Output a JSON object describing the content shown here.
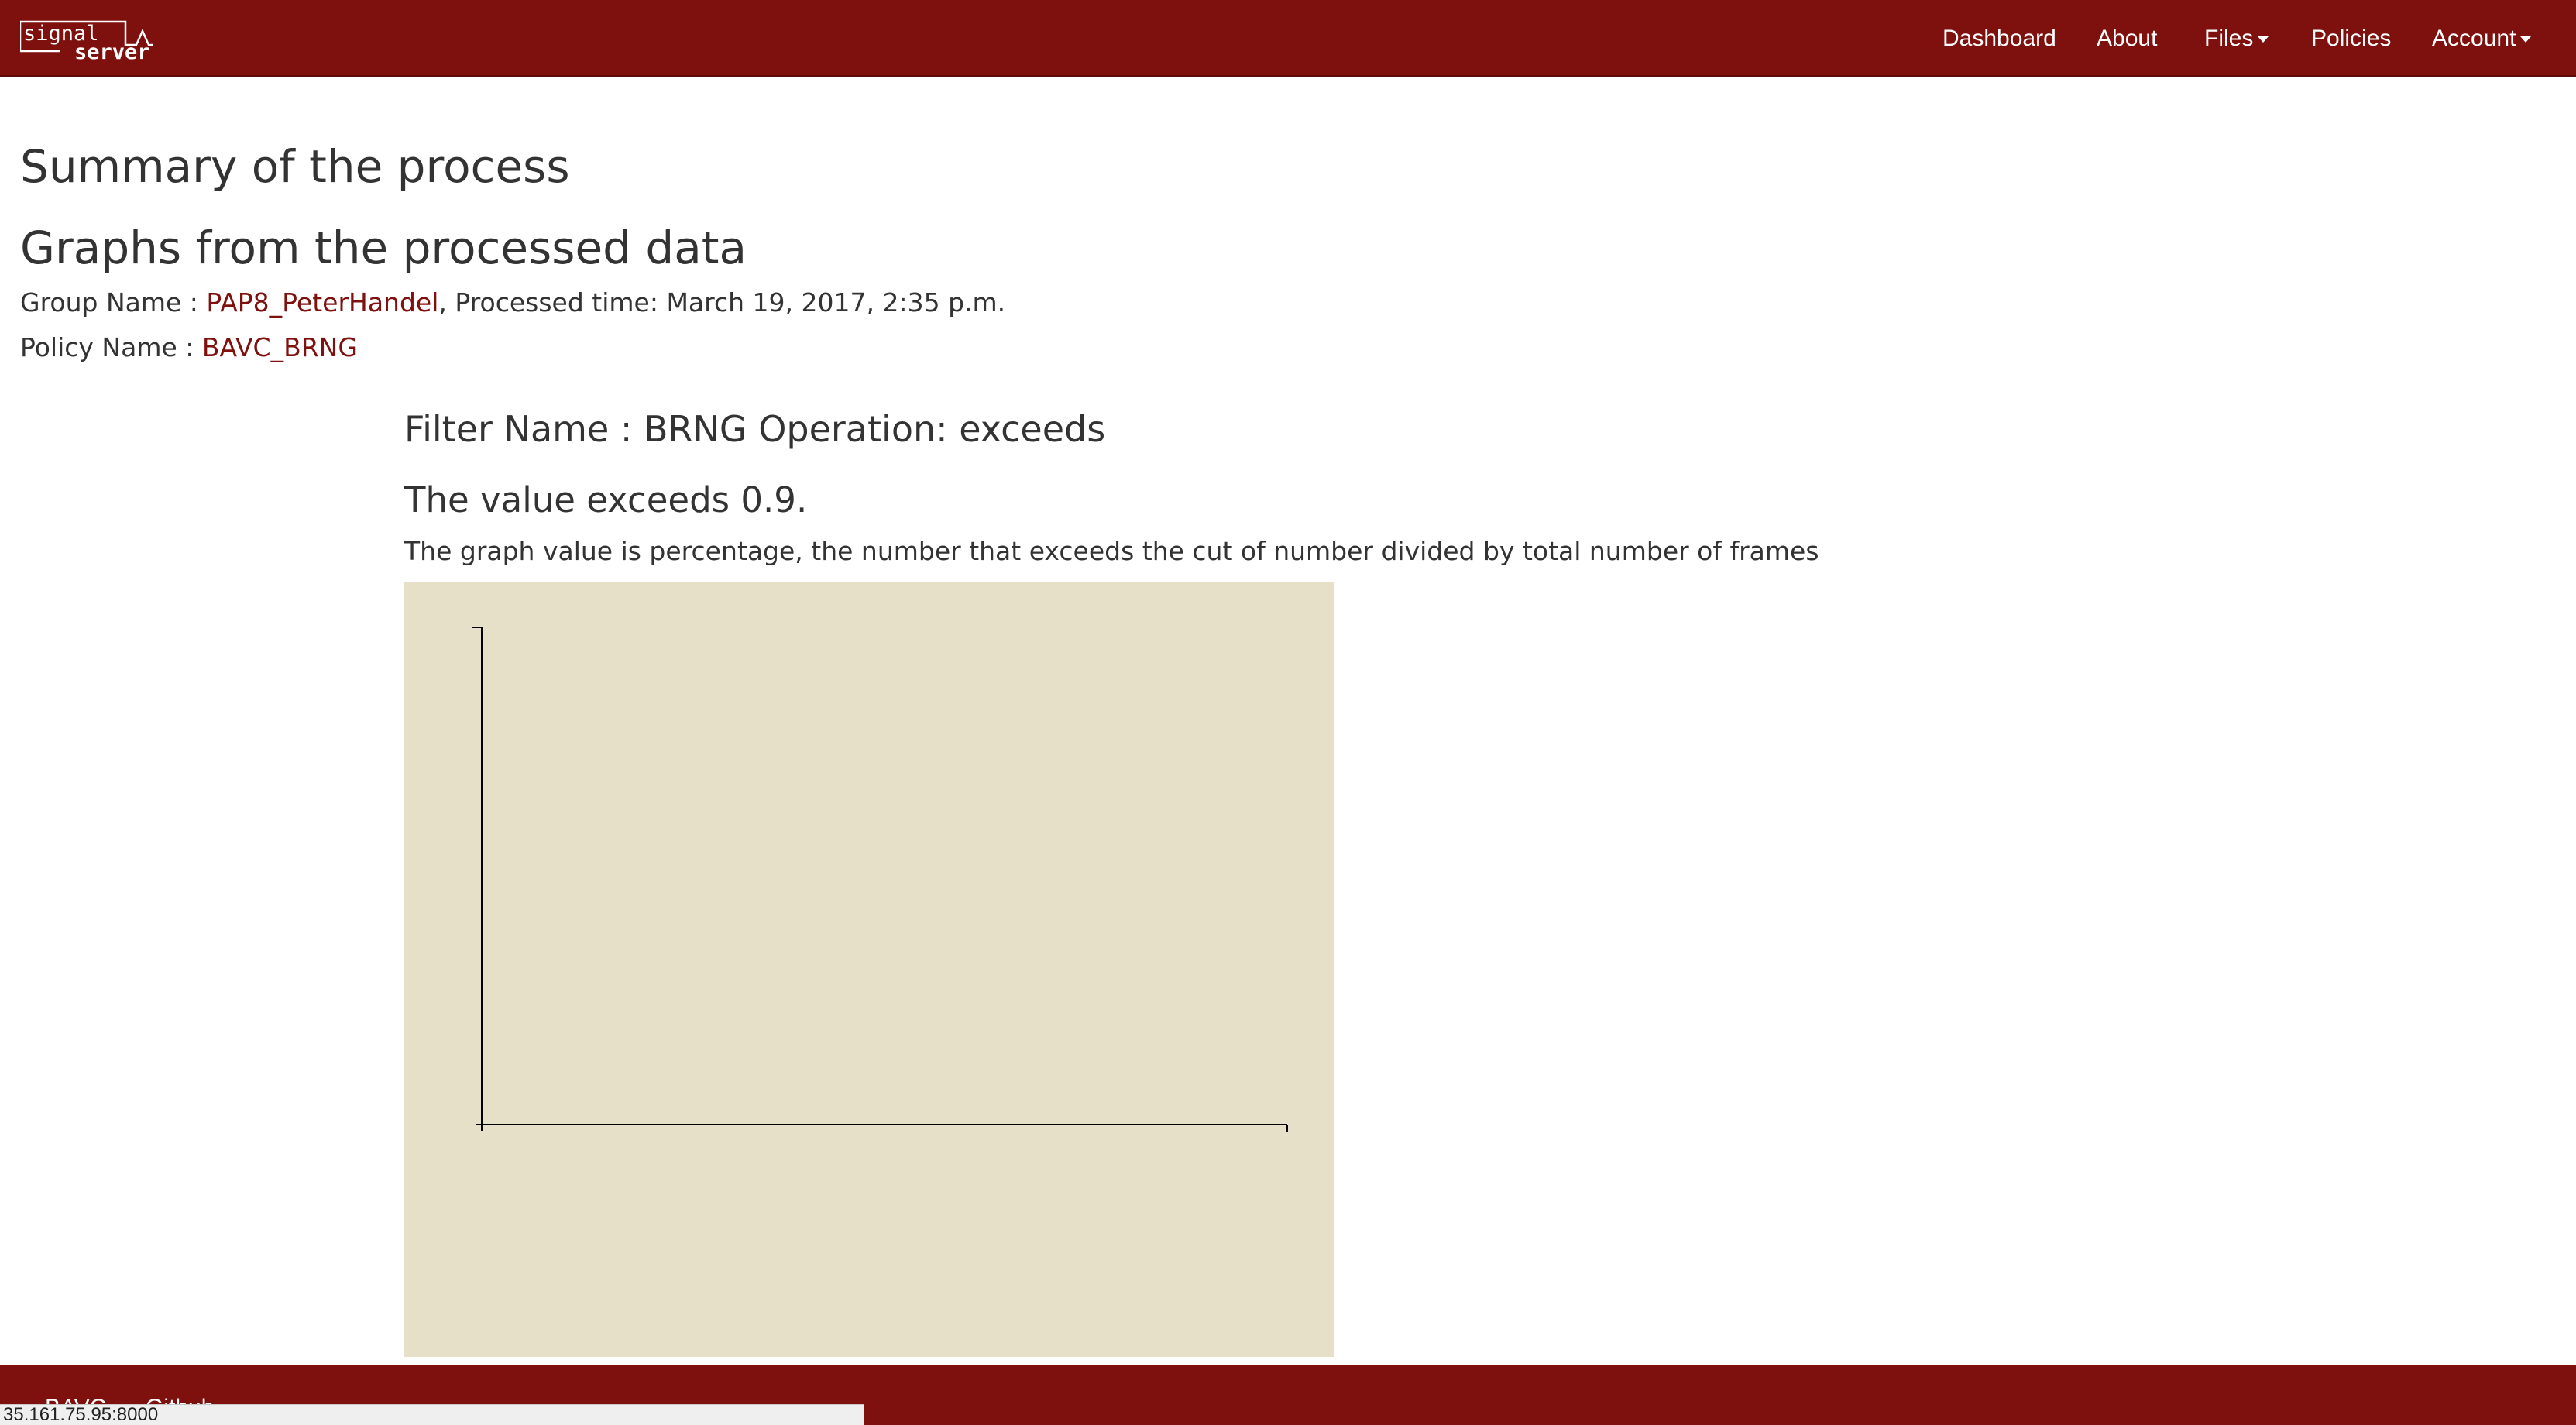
{
  "brand": {
    "logo_text_top": "signal",
    "logo_text_bottom": "server"
  },
  "nav": {
    "dashboard": "Dashboard",
    "about": "About",
    "files": "Files",
    "policies": "Policies",
    "account": "Account"
  },
  "page": {
    "summary_title": "Summary of the process",
    "graphs_title": "Graphs from the processed data",
    "group_label": "Group Name : ",
    "group_name": "PAP8_PeterHandel",
    "processed_text": ", Processed time: March 19, 2017, 2:35 p.m.",
    "policy_label": "Policy Name : ",
    "policy_name": "BAVC_BRNG",
    "filter_heading": "Filter Name : BRNG Operation: exceeds",
    "value_heading": "The value exceeds 0.9.",
    "graph_description": "The graph value is percentage, the number that exceeds the cut of number divided by total number of frames"
  },
  "chart_data": {
    "type": "bar",
    "categories": [],
    "values": [],
    "title": "",
    "xlabel": "",
    "ylabel": "",
    "grid": false,
    "background": "#e6e0c9"
  },
  "footer": {
    "bavc": "BAVC",
    "github": "Github"
  },
  "status": {
    "url": "35.161.75.95:8000"
  },
  "colors": {
    "brand": "#7e110e",
    "link": "#7e110e",
    "chart_bg": "#e6e0c9"
  }
}
